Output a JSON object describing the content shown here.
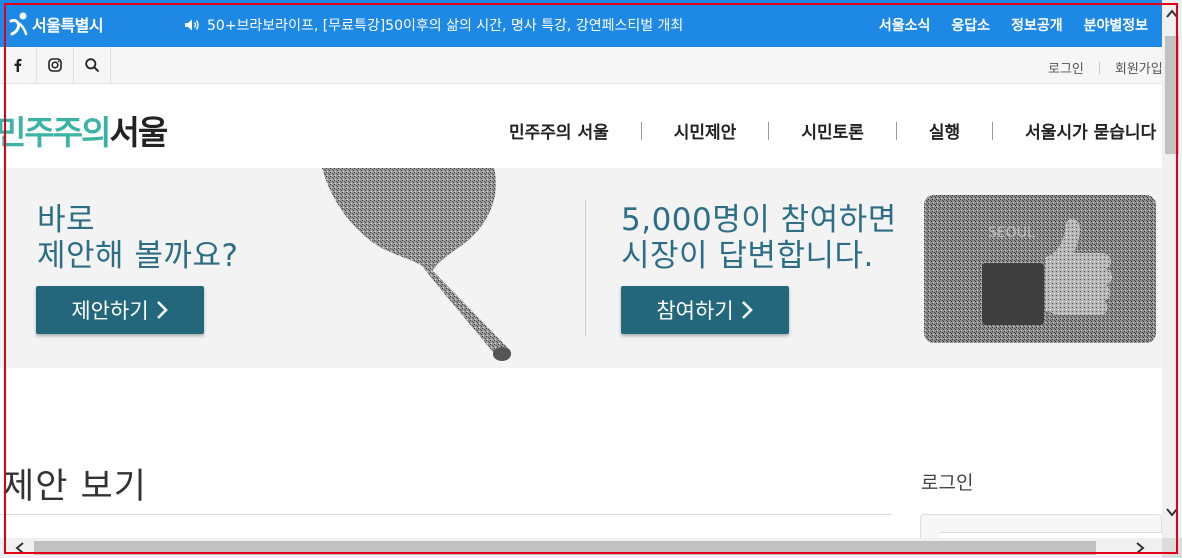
{
  "topbar": {
    "logo_text": "서울특별시",
    "ticker_text": "50+브라보라이프, [무료특강]50이후의 삶의 시간, 명사 특강, 강연페스티벌 개최",
    "links": [
      "서울소식",
      "응답소",
      "정보공개",
      "분야별정보"
    ],
    "bg_color": "#1e88e5"
  },
  "utility": {
    "social_icons": [
      "facebook-icon",
      "instagram-icon",
      "search-icon"
    ],
    "login_label": "로그인",
    "signup_label": "회원가입"
  },
  "header": {
    "brand_part1": "민주주의",
    "brand_part2": "서울",
    "brand_color": "#3bb3a5",
    "nav": [
      "민주주의 서울",
      "시민제안",
      "시민토론",
      "실행",
      "서울시가 묻습니다"
    ]
  },
  "hero": {
    "left_heading": "바로\n제안해 볼까요?",
    "left_button": "제안하기",
    "right_heading": "5,000명이 참여하면\n시장이 답변합니다.",
    "right_button": "참여하기",
    "accent_color": "#22677c"
  },
  "content": {
    "section_title": "제안 보기",
    "sidebar_title": "로그인"
  }
}
